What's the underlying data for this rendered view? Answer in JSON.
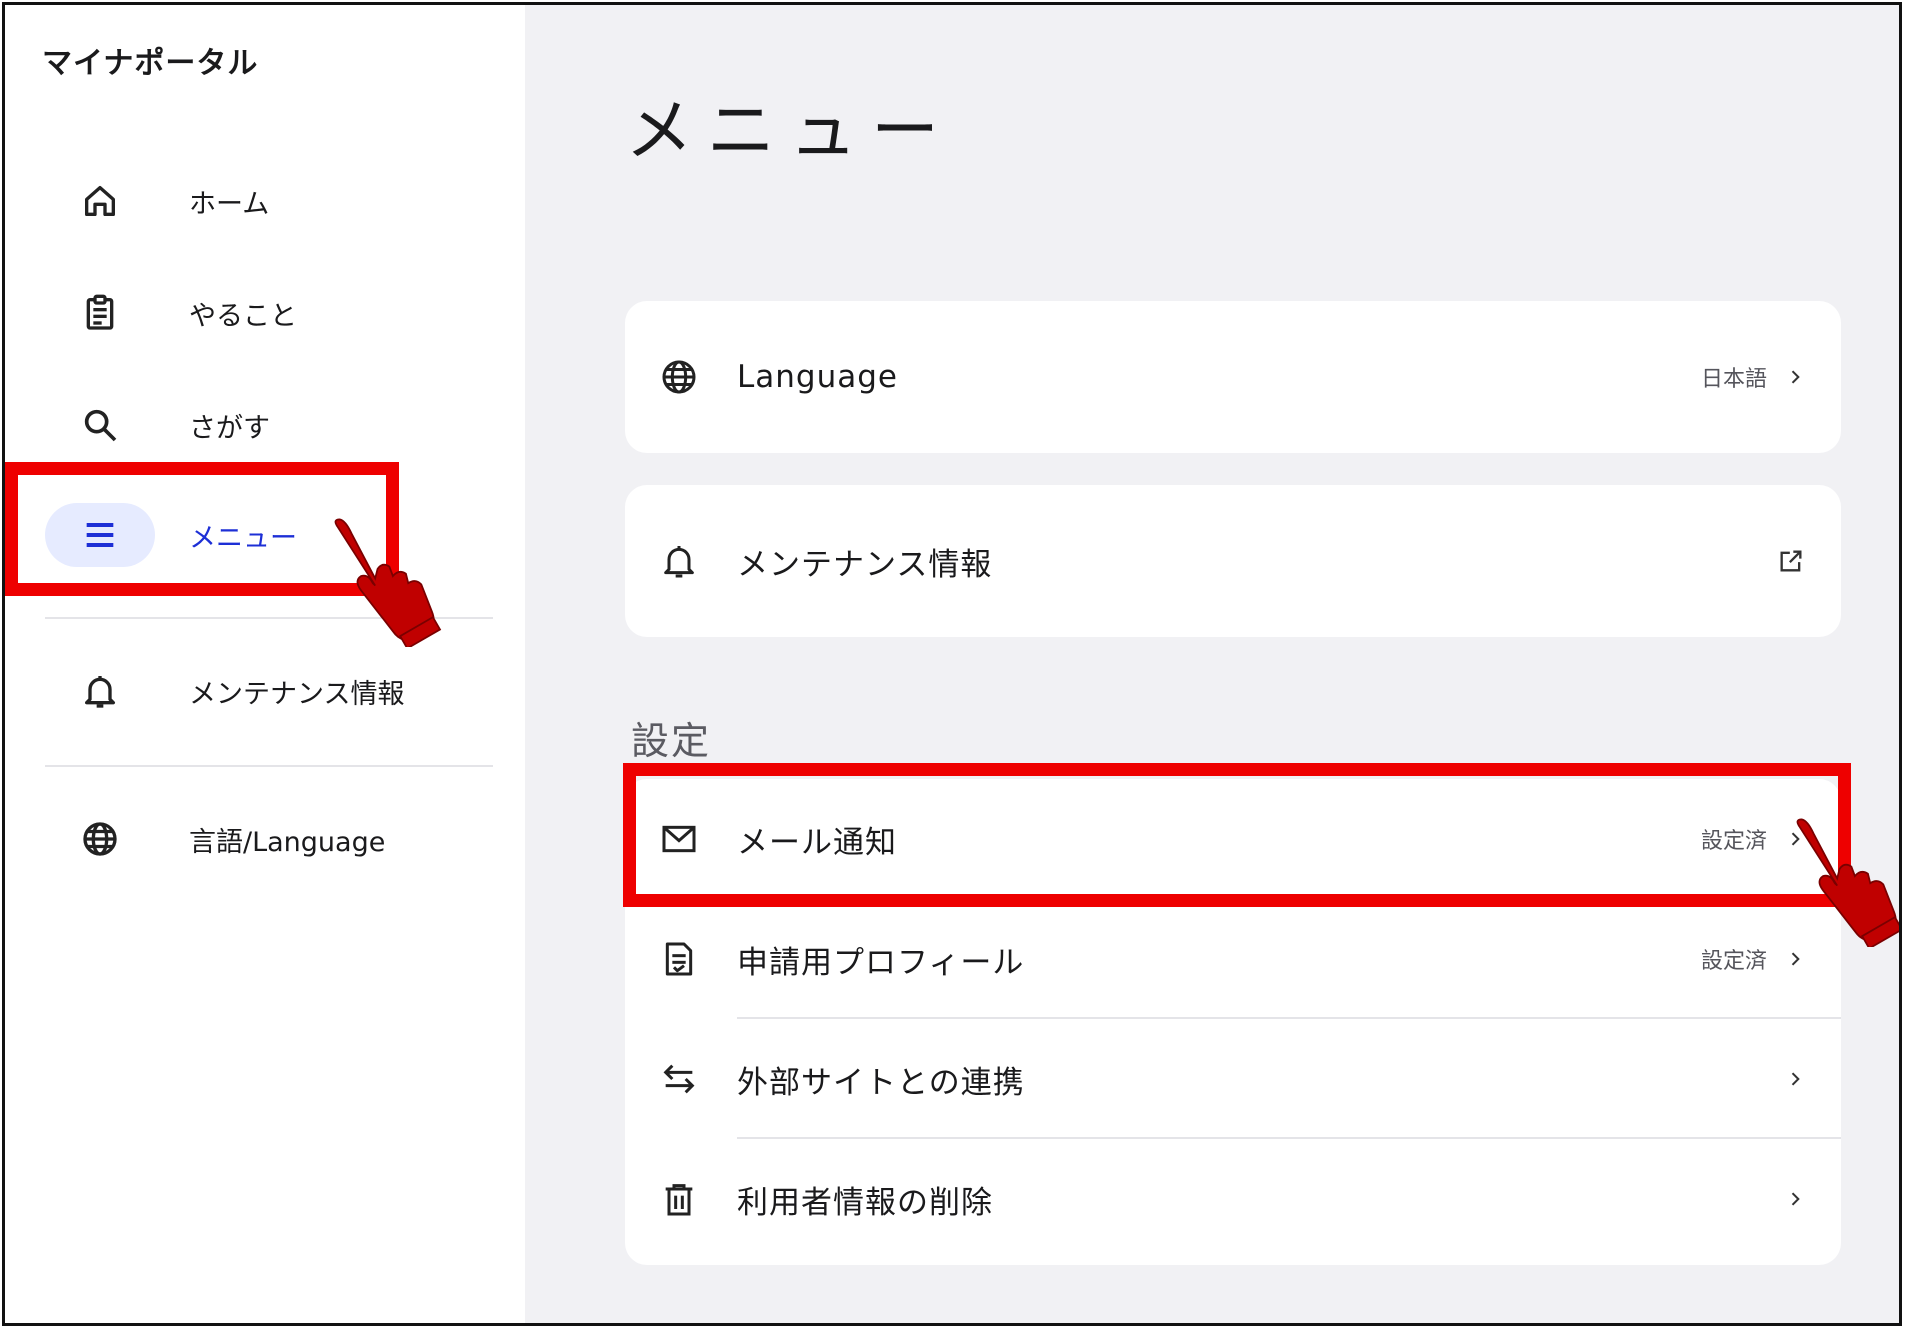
{
  "app": {
    "title": "マイナポータル"
  },
  "sidebar": {
    "items": [
      {
        "label": "ホーム",
        "icon": "home-icon"
      },
      {
        "label": "やること",
        "icon": "clipboard-icon"
      },
      {
        "label": "さがす",
        "icon": "search-icon"
      },
      {
        "label": "メニュー",
        "icon": "menu-icon",
        "active": true
      },
      {
        "label": "メンテナンス情報",
        "icon": "bell-icon"
      },
      {
        "label": "言語/Language",
        "icon": "globe-icon"
      }
    ]
  },
  "main": {
    "title": "メニュー",
    "language_card": {
      "label": "Language",
      "value": "日本語",
      "icon": "globe-icon"
    },
    "maintenance_card": {
      "label": "メンテナンス情報",
      "icon": "bell-icon",
      "trailing_icon": "external-link-icon"
    },
    "settings": {
      "heading": "設定",
      "items": [
        {
          "label": "メール通知",
          "value": "設定済",
          "icon": "mail-icon"
        },
        {
          "label": "申請用プロフィール",
          "value": "設定済",
          "icon": "document-icon"
        },
        {
          "label": "外部サイトとの連携",
          "value": "",
          "icon": "swap-arrows-icon"
        },
        {
          "label": "利用者情報の削除",
          "value": "",
          "icon": "trash-icon"
        }
      ]
    }
  },
  "colors": {
    "accent": "#1d2fd6",
    "active_bg": "#e6ebff",
    "main_bg": "#f1f1f4",
    "highlight": "#ee0000",
    "pointer_hand": "#c00000"
  }
}
